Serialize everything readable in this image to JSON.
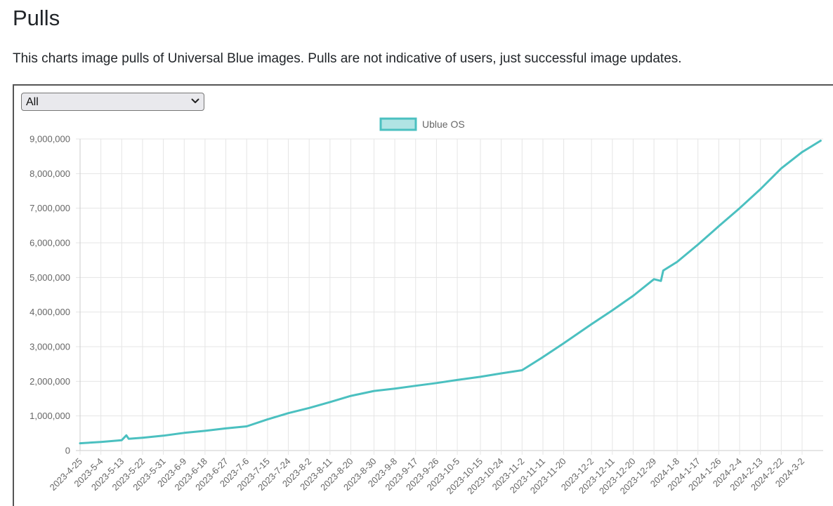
{
  "page": {
    "title": "Pulls",
    "description": "This charts image pulls of Universal Blue images. Pulls are not indicative of users, just successful image updates."
  },
  "filter": {
    "selected": "All",
    "icon": "chevron-down-icon"
  },
  "colors": {
    "line": "#4bc0c0",
    "legend_fill": "#b0e4e4",
    "grid": "#e5e5e5",
    "axis": "#cccccc"
  },
  "chart_data": {
    "type": "line",
    "title": "",
    "xlabel": "",
    "ylabel": "",
    "ylim": [
      0,
      9000000
    ],
    "y_ticks": [
      0,
      1000000,
      2000000,
      3000000,
      4000000,
      5000000,
      6000000,
      7000000,
      8000000,
      9000000
    ],
    "y_tick_labels": [
      "0",
      "1,000,000",
      "2,000,000",
      "3,000,000",
      "4,000,000",
      "5,000,000",
      "6,000,000",
      "7,000,000",
      "8,000,000",
      "9,000,000"
    ],
    "x_tick_labels": [
      "2023-4-25",
      "2023-5-4",
      "2023-5-13",
      "2023-5-22",
      "2023-5-31",
      "2023-6-9",
      "2023-6-18",
      "2023-6-27",
      "2023-7-6",
      "2023-7-15",
      "2023-7-24",
      "2023-8-2",
      "2023-8-11",
      "2023-8-20",
      "2023-8-30",
      "2023-9-8",
      "2023-9-17",
      "2023-9-26",
      "2023-10-5",
      "2023-10-15",
      "2023-10-24",
      "2023-11-2",
      "2023-11-11",
      "2023-11-20",
      "2023-12-2",
      "2023-12-11",
      "2023-12-20",
      "2023-12-29",
      "2024-1-8",
      "2024-1-17",
      "2024-1-26",
      "2024-2-4",
      "2024-2-13",
      "2024-2-22",
      "2024-3-2"
    ],
    "grid": true,
    "legend_position": "top-center",
    "series": [
      {
        "name": "Ublue OS",
        "x": [
          "2023-4-25",
          "2023-5-4",
          "2023-5-13",
          "2023-5-15",
          "2023-5-16",
          "2023-5-22",
          "2023-5-31",
          "2023-6-9",
          "2023-6-18",
          "2023-6-27",
          "2023-7-6",
          "2023-7-15",
          "2023-7-24",
          "2023-8-2",
          "2023-8-11",
          "2023-8-20",
          "2023-8-30",
          "2023-9-8",
          "2023-9-17",
          "2023-9-26",
          "2023-10-5",
          "2023-10-15",
          "2023-10-24",
          "2023-11-2",
          "2023-11-11",
          "2023-11-20",
          "2023-12-2",
          "2023-12-11",
          "2023-12-20",
          "2023-12-29",
          "2024-1-1",
          "2024-1-2",
          "2024-1-8",
          "2024-1-17",
          "2024-1-26",
          "2024-2-4",
          "2024-2-13",
          "2024-2-22",
          "2024-3-2",
          "2024-3-10"
        ],
        "values": [
          210000,
          250000,
          300000,
          440000,
          340000,
          370000,
          430000,
          510000,
          570000,
          640000,
          700000,
          900000,
          1080000,
          1230000,
          1400000,
          1580000,
          1720000,
          1790000,
          1870000,
          1950000,
          2040000,
          2130000,
          2230000,
          2320000,
          2700000,
          3100000,
          3650000,
          4050000,
          4470000,
          4950000,
          4900000,
          5200000,
          5450000,
          5950000,
          6480000,
          7000000,
          7550000,
          8150000,
          8620000,
          8950000
        ]
      }
    ]
  }
}
